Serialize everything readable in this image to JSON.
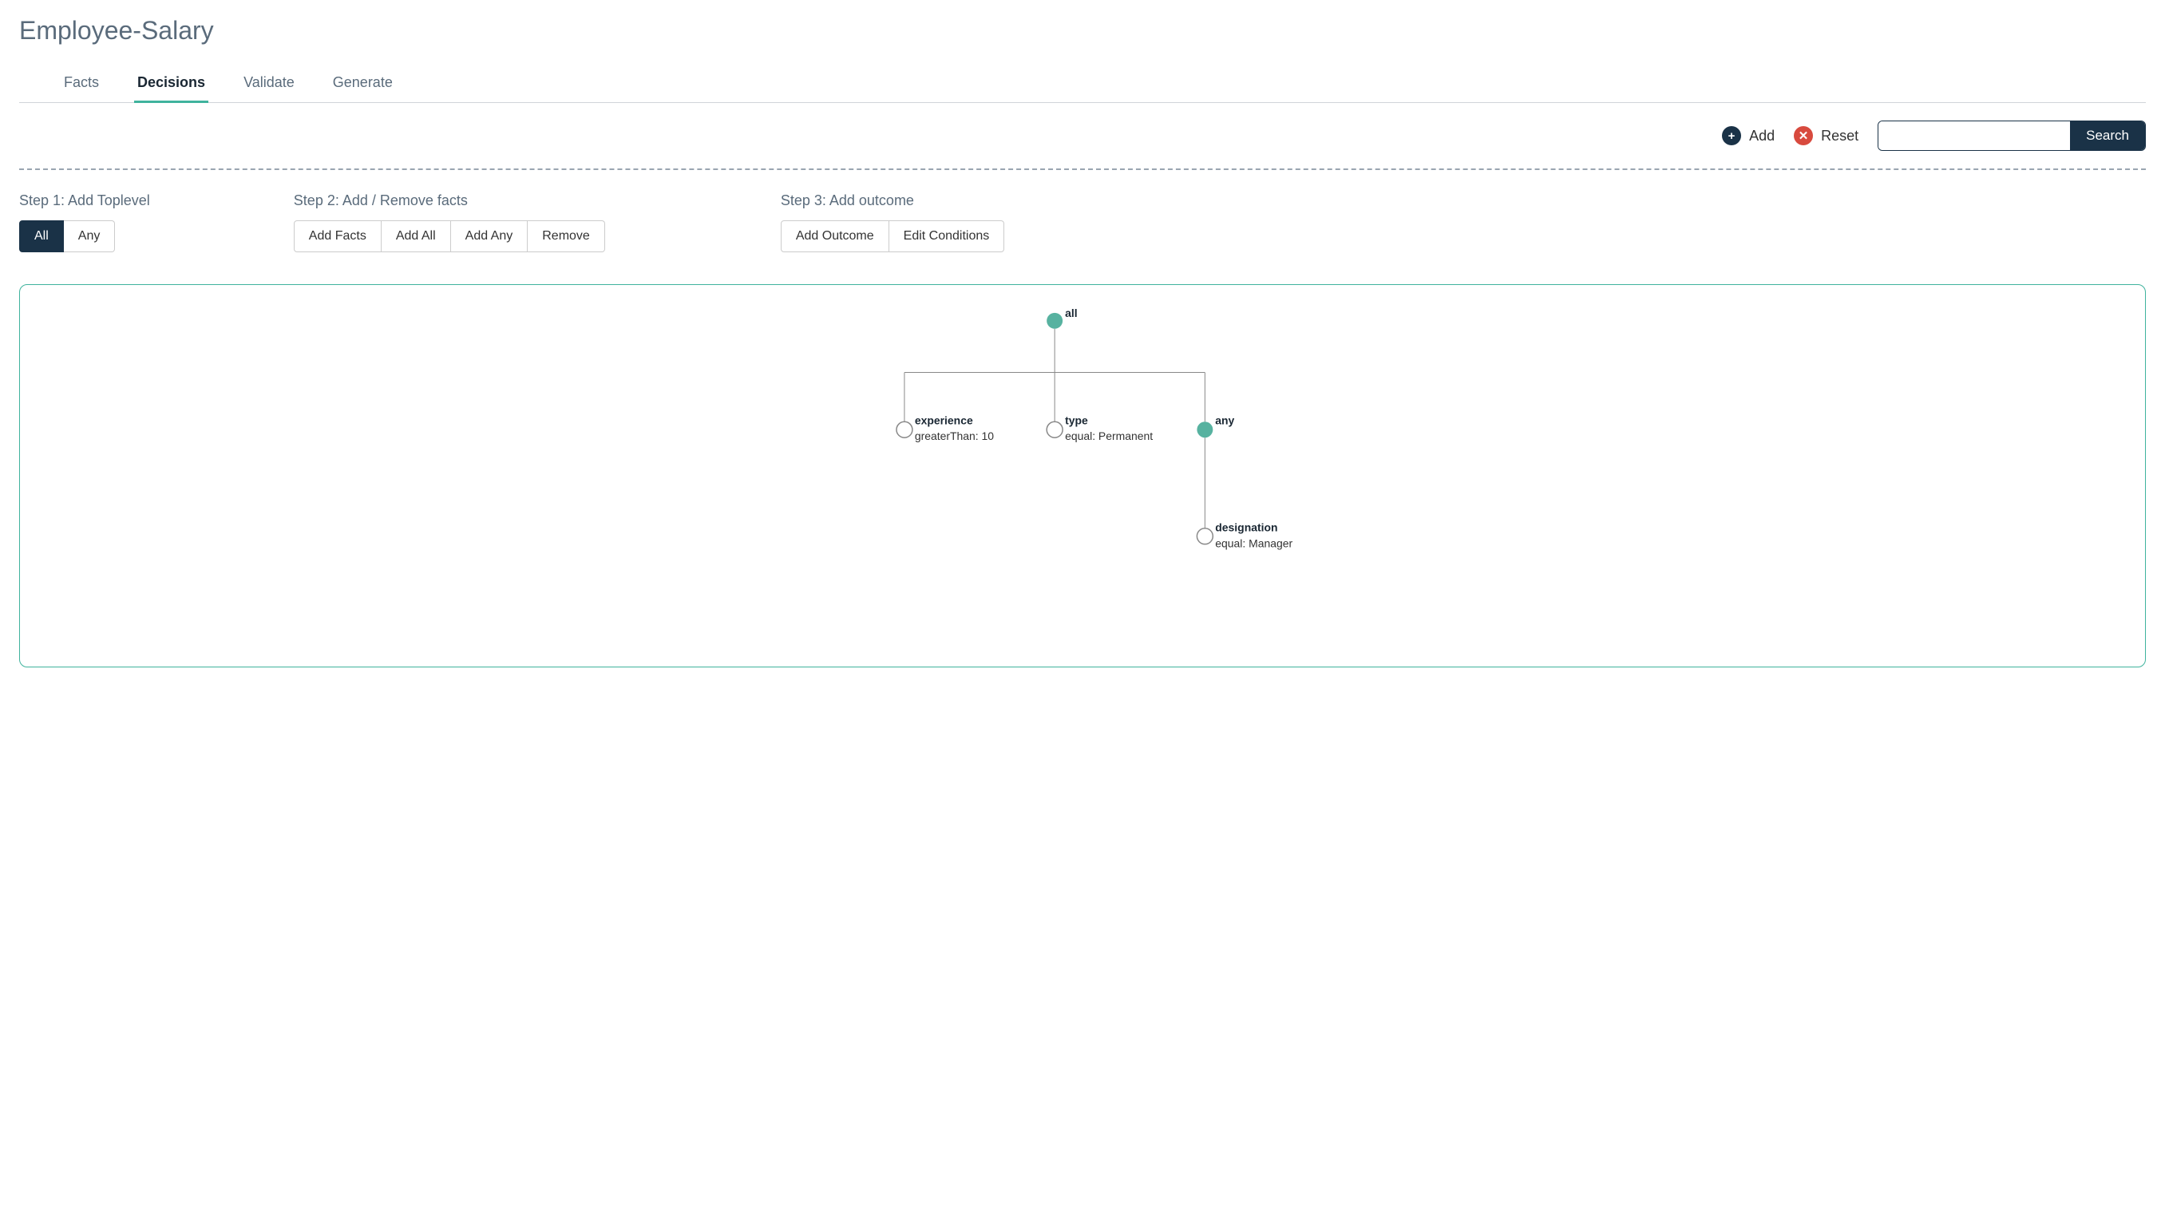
{
  "page": {
    "title": "Employee-Salary"
  },
  "tabs": [
    {
      "label": "Facts",
      "active": false
    },
    {
      "label": "Decisions",
      "active": true
    },
    {
      "label": "Validate",
      "active": false
    },
    {
      "label": "Generate",
      "active": false
    }
  ],
  "toolbar": {
    "add_label": "Add",
    "reset_label": "Reset",
    "search_placeholder": "",
    "search_button": "Search"
  },
  "steps": {
    "step1": {
      "title": "Step 1: Add Toplevel",
      "buttons": [
        {
          "label": "All",
          "active": true
        },
        {
          "label": "Any",
          "active": false
        }
      ]
    },
    "step2": {
      "title": "Step 2: Add / Remove facts",
      "buttons": [
        {
          "label": "Add Facts"
        },
        {
          "label": "Add All"
        },
        {
          "label": "Add Any"
        },
        {
          "label": "Remove"
        }
      ]
    },
    "step3": {
      "title": "Step 3: Add outcome",
      "buttons": [
        {
          "label": "Add Outcome"
        },
        {
          "label": "Edit Conditions"
        }
      ]
    }
  },
  "tree": {
    "root": {
      "label": "all",
      "type": "group",
      "children": [
        {
          "label": "experience",
          "sub": "greaterThan: 10",
          "type": "leaf"
        },
        {
          "label": "type",
          "sub": "equal: Permanent",
          "type": "leaf"
        },
        {
          "label": "any",
          "type": "group",
          "children": [
            {
              "label": "designation",
              "sub": "equal: Manager",
              "type": "leaf"
            }
          ]
        }
      ]
    }
  }
}
